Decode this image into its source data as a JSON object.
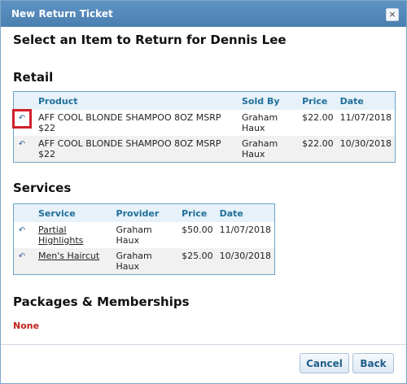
{
  "dialog": {
    "title": "New Return Ticket",
    "close_glyph": "×"
  },
  "heading": "Select an Item to Return for Dennis Lee",
  "retail": {
    "title": "Retail",
    "columns": [
      "Product",
      "Sold By",
      "Price",
      "Date"
    ],
    "rows": [
      {
        "product": "AFF COOL BLONDE SHAMPOO 8OZ MSRP $22",
        "sold_by": "Graham Haux",
        "price": "$22.00",
        "date": "11/07/2018"
      },
      {
        "product": "AFF COOL BLONDE SHAMPOO 8OZ MSRP $22",
        "sold_by": "Graham Haux",
        "price": "$22.00",
        "date": "10/30/2018"
      }
    ]
  },
  "services": {
    "title": "Services",
    "columns": [
      "Service",
      "Provider",
      "Price",
      "Date"
    ],
    "rows": [
      {
        "service": "Partial Highlights",
        "provider": "Graham Haux",
        "price": "$50.00",
        "date": "11/07/2018"
      },
      {
        "service": "Men's Haircut",
        "provider": "Graham Haux",
        "price": "$25.00",
        "date": "10/30/2018"
      }
    ]
  },
  "packages": {
    "title": "Packages & Memberships",
    "none_label": "None"
  },
  "buttons": {
    "cancel": "Cancel",
    "back": "Back"
  },
  "icons": {
    "return": "return-arrow-icon",
    "close": "close-icon"
  },
  "colors": {
    "titlebar": "#4a7fb1",
    "header_text": "#1f6f9a",
    "none": "#c0201a",
    "highlight": "#d0202a"
  }
}
